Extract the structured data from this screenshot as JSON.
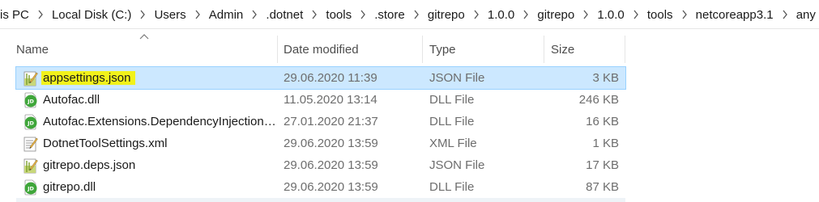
{
  "breadcrumbs": [
    "is PC",
    "Local Disk (C:)",
    "Users",
    "Admin",
    ".dotnet",
    "tools",
    ".store",
    "gitrepo",
    "1.0.0",
    "gitrepo",
    "1.0.0",
    "tools",
    "netcoreapp3.1",
    "any"
  ],
  "columns": {
    "name": "Name",
    "date": "Date modified",
    "type": "Type",
    "size": "Size"
  },
  "files": [
    {
      "name": "appsettings.json",
      "date": "29.06.2020 11:39",
      "type": "JSON File",
      "size": "3 KB",
      "icon": "json-file-icon",
      "selected": true,
      "highlighted": true
    },
    {
      "name": "Autofac.dll",
      "date": "11.05.2020 13:14",
      "type": "DLL File",
      "size": "246 KB",
      "icon": "dll-file-icon"
    },
    {
      "name": "Autofac.Extensions.DependencyInjection....",
      "date": "27.01.2020 21:37",
      "type": "DLL File",
      "size": "16 KB",
      "icon": "dll-file-icon"
    },
    {
      "name": "DotnetToolSettings.xml",
      "date": "29.06.2020 13:59",
      "type": "XML File",
      "size": "1 KB",
      "icon": "xml-file-icon"
    },
    {
      "name": "gitrepo.deps.json",
      "date": "29.06.2020 13:59",
      "type": "JSON File",
      "size": "17 KB",
      "icon": "json-file-icon"
    },
    {
      "name": "gitrepo.dll",
      "date": "29.06.2020 13:59",
      "type": "DLL File",
      "size": "87 KB",
      "icon": "dll-file-icon"
    }
  ],
  "colors": {
    "selection": "#cce8ff",
    "highlight": "#f2f21a",
    "dll_icon": "#3fa63a"
  }
}
